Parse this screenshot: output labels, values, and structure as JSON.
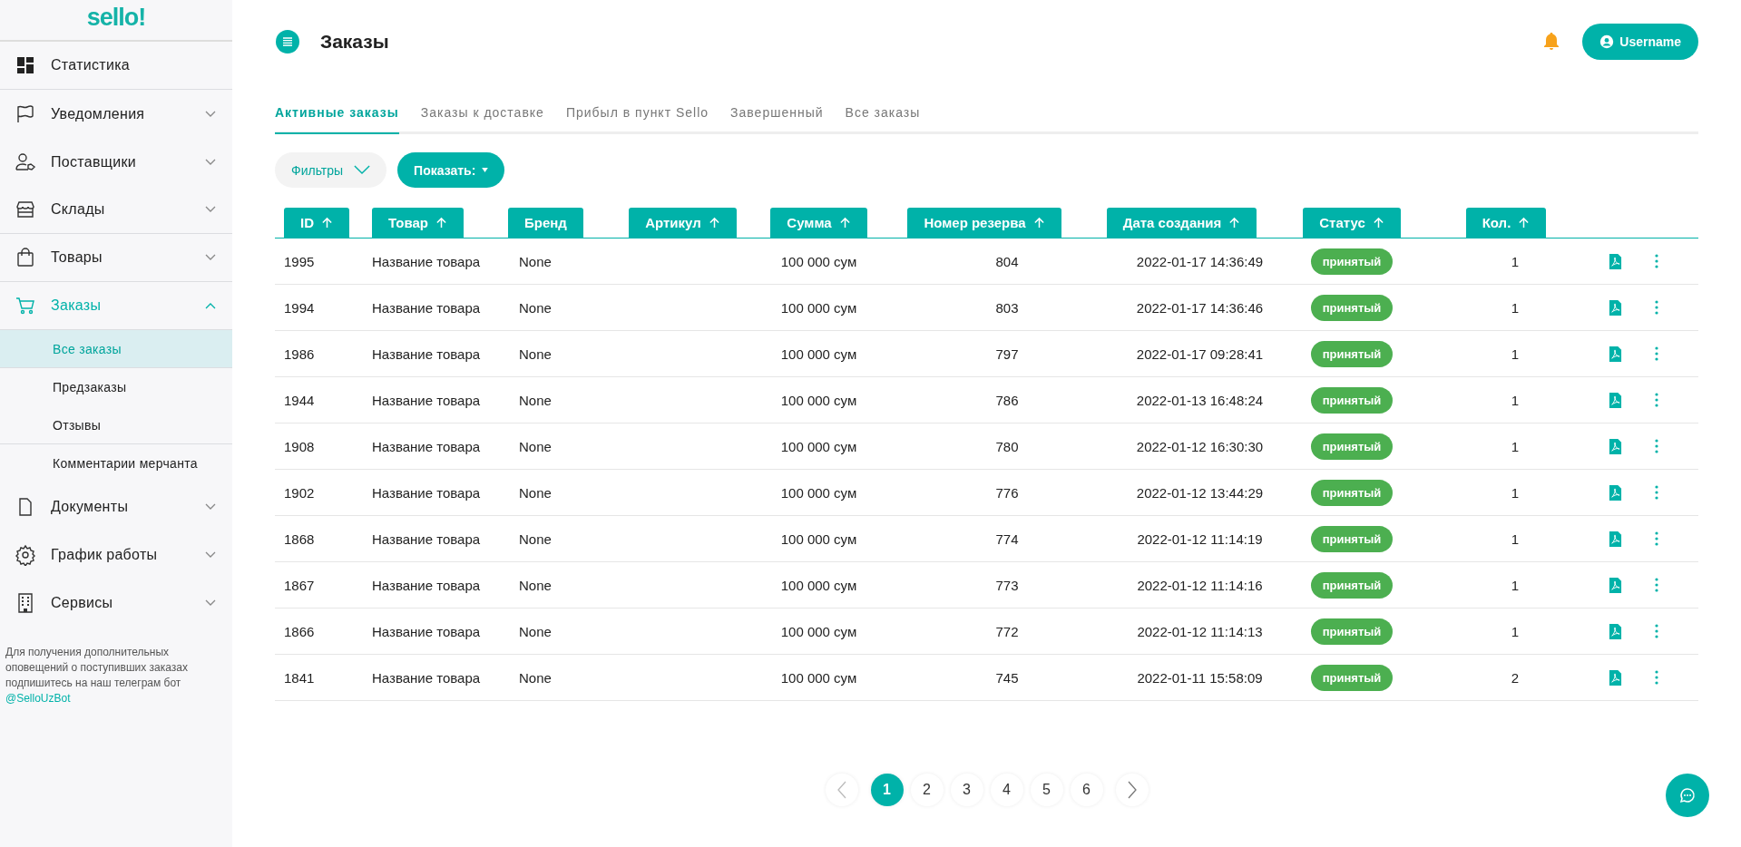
{
  "logo": {
    "text": "sello!"
  },
  "sidebar": {
    "items": [
      {
        "label": "Статистика",
        "kind": "link",
        "divider": true
      },
      {
        "label": "Уведомления",
        "kind": "group",
        "expanded": false,
        "divider": false
      },
      {
        "label": "Поставщики",
        "kind": "group",
        "expanded": false,
        "divider": false
      },
      {
        "label": "Склады",
        "kind": "group",
        "expanded": false,
        "divider": true
      },
      {
        "label": "Товары",
        "kind": "group",
        "expanded": false,
        "divider": true
      },
      {
        "label": "Заказы",
        "kind": "group",
        "expanded": true,
        "divider": true,
        "children": [
          {
            "label": "Все заказы",
            "selected": true,
            "divider": true
          },
          {
            "label": "Предзаказы",
            "selected": false,
            "divider": false
          },
          {
            "label": "Отзывы",
            "selected": false,
            "divider": true
          },
          {
            "label": "Комментарии мерчанта",
            "selected": false,
            "divider": false
          }
        ]
      },
      {
        "label": "Документы",
        "kind": "group",
        "expanded": false,
        "divider": false
      },
      {
        "label": "График работы",
        "kind": "group",
        "expanded": false,
        "divider": false
      },
      {
        "label": "Сервисы",
        "kind": "group",
        "expanded": false,
        "divider": false
      }
    ],
    "note": {
      "text": "Для получения дополнительных оповещений о поступивших заказах подпишитесь на наш телеграм бот",
      "link": "@SelloUzBot"
    }
  },
  "header": {
    "title": "Заказы",
    "user_button": "Username"
  },
  "tabs": [
    {
      "label": "Активные заказы",
      "selected": true
    },
    {
      "label": "Заказы к доставке",
      "selected": false
    },
    {
      "label": "Прибыл в пункт Sello",
      "selected": false
    },
    {
      "label": "Завершенный",
      "selected": false
    },
    {
      "label": "Все заказы",
      "selected": false
    }
  ],
  "filters_button": "Фильтры",
  "show_button": "Показать:",
  "table": {
    "columns": [
      {
        "label": "ID",
        "sortable": true
      },
      {
        "label": "Товар",
        "sortable": true
      },
      {
        "label": "Бренд",
        "sortable": false
      },
      {
        "label": "Артикул",
        "sortable": true
      },
      {
        "label": "Сумма",
        "sortable": true
      },
      {
        "label": "Номер резерва",
        "sortable": true
      },
      {
        "label": "Дата создания",
        "sortable": true
      },
      {
        "label": "Статус",
        "sortable": true
      },
      {
        "label": "Кол.",
        "sortable": true
      }
    ],
    "rows": [
      {
        "id": "1995",
        "product": "Название товара",
        "brand": "None",
        "amount": "100 000 сум",
        "reserve": "804",
        "created": "2022-01-17 14:36:49",
        "status": "принятый",
        "qty": "1"
      },
      {
        "id": "1994",
        "product": "Название товара",
        "brand": "None",
        "amount": "100 000 сум",
        "reserve": "803",
        "created": "2022-01-17 14:36:46",
        "status": "принятый",
        "qty": "1"
      },
      {
        "id": "1986",
        "product": "Название товара",
        "brand": "None",
        "amount": "100 000 сум",
        "reserve": "797",
        "created": "2022-01-17 09:28:41",
        "status": "принятый",
        "qty": "1"
      },
      {
        "id": "1944",
        "product": "Название товара",
        "brand": "None",
        "amount": "100 000 сум",
        "reserve": "786",
        "created": "2022-01-13 16:48:24",
        "status": "принятый",
        "qty": "1"
      },
      {
        "id": "1908",
        "product": "Название товара",
        "brand": "None",
        "amount": "100 000 сум",
        "reserve": "780",
        "created": "2022-01-12 16:30:30",
        "status": "принятый",
        "qty": "1"
      },
      {
        "id": "1902",
        "product": "Название товара",
        "brand": "None",
        "amount": "100 000 сум",
        "reserve": "776",
        "created": "2022-01-12 13:44:29",
        "status": "принятый",
        "qty": "1"
      },
      {
        "id": "1868",
        "product": "Название товара",
        "brand": "None",
        "amount": "100 000 сум",
        "reserve": "774",
        "created": "2022-01-12 11:14:19",
        "status": "принятый",
        "qty": "1"
      },
      {
        "id": "1867",
        "product": "Название товара",
        "brand": "None",
        "amount": "100 000 сум",
        "reserve": "773",
        "created": "2022-01-12 11:14:16",
        "status": "принятый",
        "qty": "1"
      },
      {
        "id": "1866",
        "product": "Название товара",
        "brand": "None",
        "amount": "100 000 сум",
        "reserve": "772",
        "created": "2022-01-12 11:14:13",
        "status": "принятый",
        "qty": "1"
      },
      {
        "id": "1841",
        "product": "Название товара",
        "brand": "None",
        "amount": "100 000 сум",
        "reserve": "745",
        "created": "2022-01-11 15:58:09",
        "status": "принятый",
        "qty": "2"
      }
    ]
  },
  "pagination": {
    "pages": [
      {
        "label": "1",
        "selected": true
      },
      {
        "label": "2",
        "selected": false
      },
      {
        "label": "3",
        "selected": false
      },
      {
        "label": "4",
        "selected": false
      },
      {
        "label": "5",
        "selected": false
      },
      {
        "label": "6",
        "selected": false
      }
    ]
  }
}
